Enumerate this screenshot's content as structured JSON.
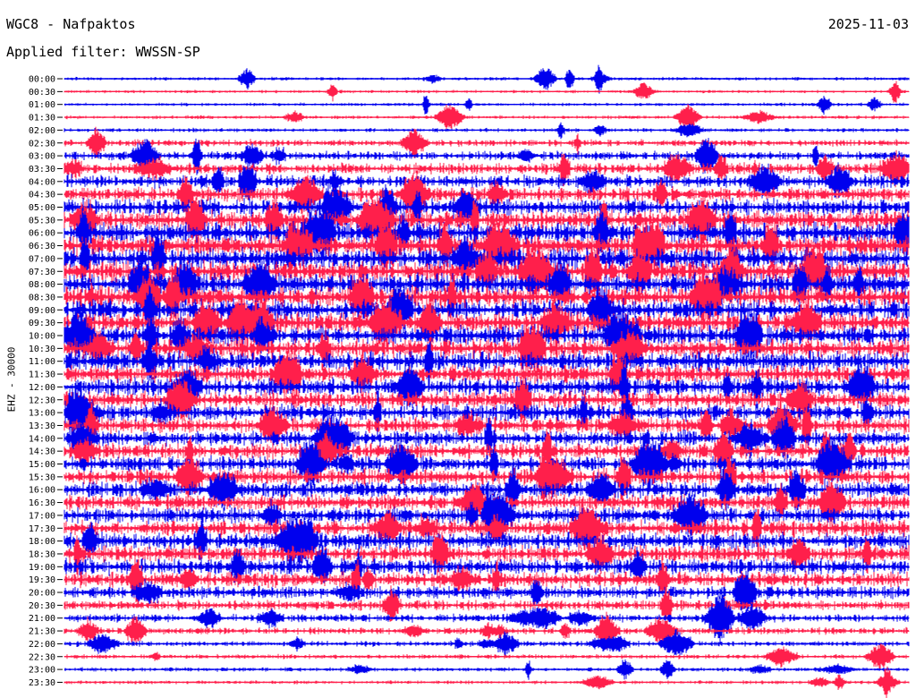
{
  "header": {
    "station": "WGC8 - Nafpaktos",
    "date": "2025-11-03",
    "filter_label": "Applied filter: WWSSN-SP"
  },
  "axis": {
    "side_label": "EHZ - 30000"
  },
  "colors": {
    "trace_even": "#0000ee",
    "trace_odd": "#ff1f4b",
    "background": "#ffffff"
  },
  "chart_data": {
    "type": "line",
    "chart_kind": "helicorder",
    "ylabel": "EHZ - 30000",
    "grid": false,
    "minutes_per_line": 30,
    "row_labels": [
      "00:00",
      "00:30",
      "01:00",
      "01:30",
      "02:00",
      "02:30",
      "03:00",
      "03:30",
      "04:00",
      "04:30",
      "05:00",
      "05:30",
      "06:00",
      "06:30",
      "07:00",
      "07:30",
      "08:00",
      "08:30",
      "09:00",
      "09:30",
      "10:00",
      "10:30",
      "11:00",
      "11:30",
      "12:00",
      "12:30",
      "13:00",
      "13:30",
      "14:00",
      "14:30",
      "15:00",
      "15:30",
      "16:00",
      "16:30",
      "17:00",
      "17:30",
      "18:00",
      "18:30",
      "19:00",
      "19:30",
      "20:00",
      "20:30",
      "21:00",
      "21:30",
      "22:00",
      "22:30",
      "23:00",
      "23:30"
    ],
    "relative_amplitude": [
      0.15,
      0.14,
      0.15,
      0.16,
      0.18,
      0.3,
      0.4,
      0.5,
      0.6,
      0.62,
      0.75,
      0.85,
      0.92,
      0.95,
      0.95,
      0.96,
      0.95,
      0.95,
      0.92,
      0.9,
      0.88,
      0.86,
      0.85,
      0.82,
      0.8,
      0.75,
      0.72,
      0.72,
      0.7,
      0.7,
      0.72,
      0.72,
      0.72,
      0.7,
      0.72,
      0.75,
      0.75,
      0.72,
      0.7,
      0.68,
      0.55,
      0.45,
      0.35,
      0.3,
      0.25,
      0.2,
      0.18,
      0.16
    ]
  }
}
